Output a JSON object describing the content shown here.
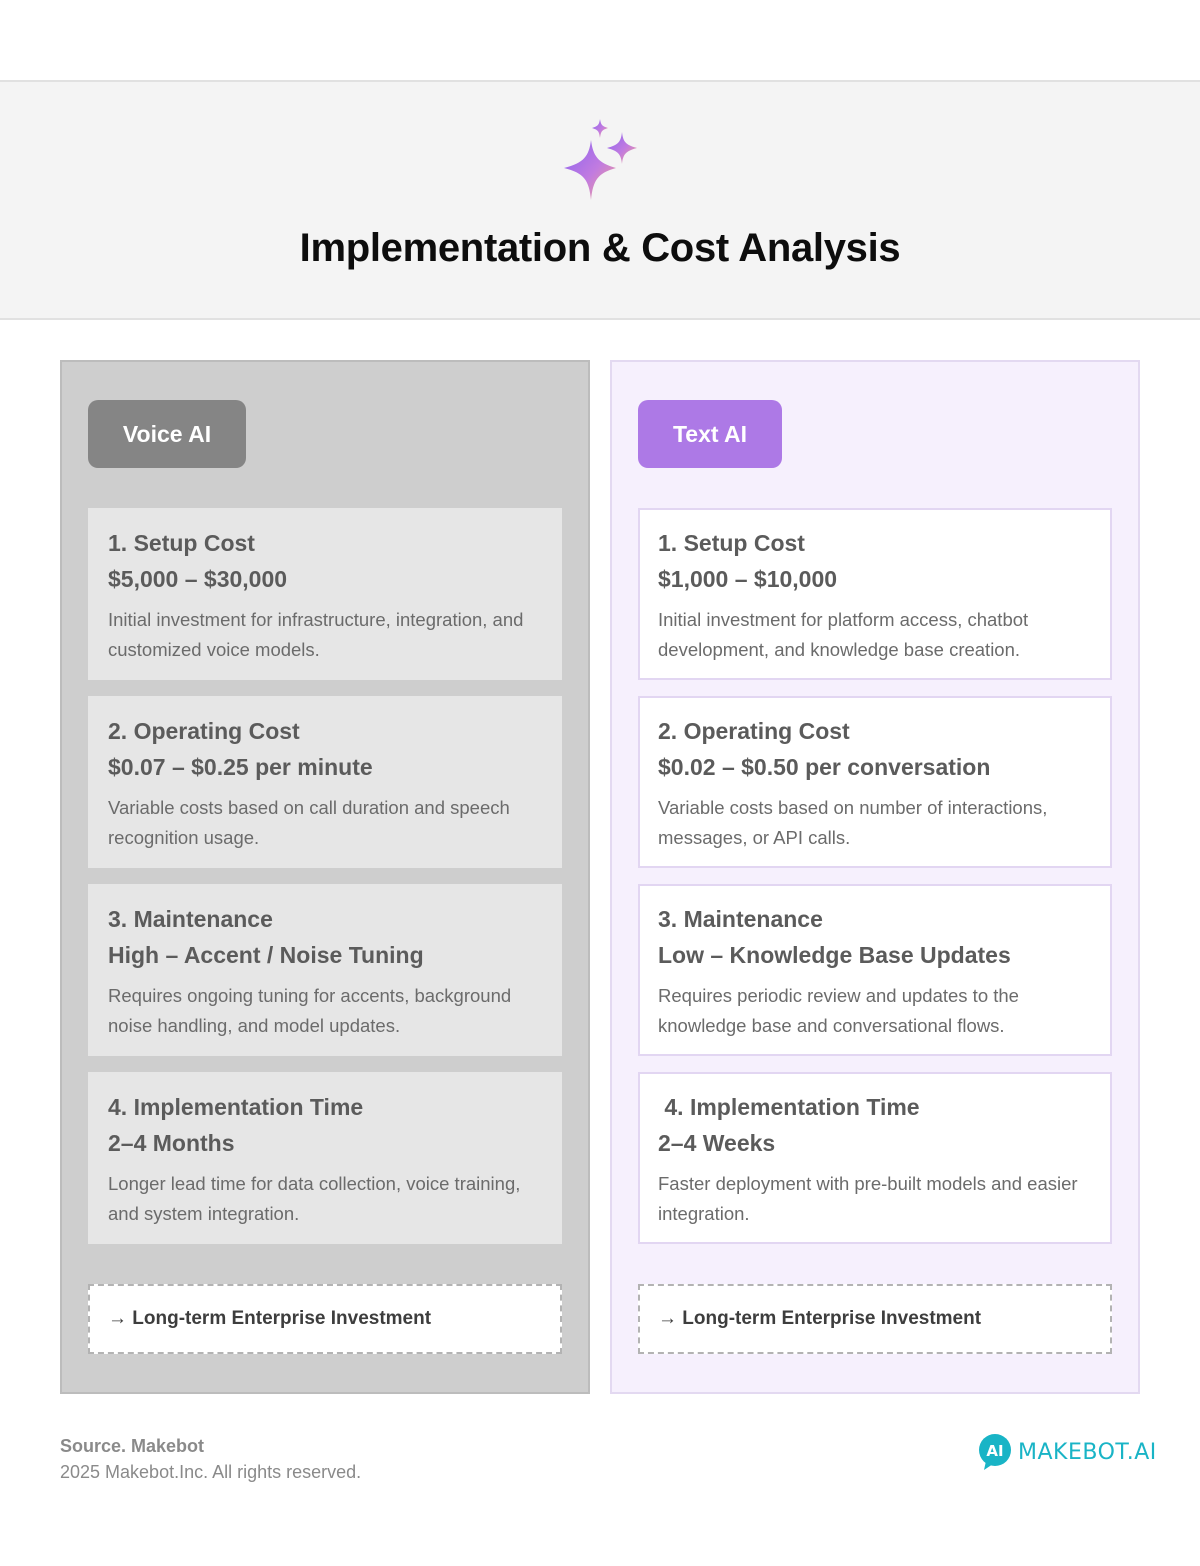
{
  "header": {
    "title": "Implementation & Cost Analysis",
    "icon": "sparkle-icon",
    "background": "#f4f4f4"
  },
  "voice": {
    "tag": "Voice AI",
    "tag_color": "#858585",
    "panel_color": "#cecece",
    "cards": [
      {
        "head": "1. Setup Cost",
        "value": "$5,000 – $30,000",
        "desc": "Initial investment for infrastructure, integration, and customized voice models."
      },
      {
        "head": "2. Operating Cost",
        "value": "$0.07 – $0.25 per minute",
        "desc": "Variable costs based on call duration and speech recognition usage."
      },
      {
        "head": "3. Maintenance",
        "value": "High – Accent / Noise Tuning",
        "desc": "Requires ongoing tuning for accents, background noise handling, and model updates."
      },
      {
        "head": "4. Implementation Time",
        "value": "2–4 Months",
        "desc": "Longer lead time for data collection, voice training, and system integration."
      }
    ],
    "footer": "→ Long-term Enterprise Investment"
  },
  "text": {
    "tag": "Text AI",
    "tag_color": "#ad79e6",
    "panel_color": "#f6f0fd",
    "cards": [
      {
        "head": "1. Setup Cost",
        "value": "$1,000 – $10,000",
        "desc": "Initial investment for platform access, chatbot development, and knowledge base creation."
      },
      {
        "head": "2. Operating Cost",
        "value": "$0.02 – $0.50 per conversation",
        "desc": "Variable costs based on number of interactions, messages, or API calls."
      },
      {
        "head": "3. Maintenance",
        "value": "Low – Knowledge Base Updates",
        "desc": "Requires periodic review and updates to the knowledge base and conversational flows."
      },
      {
        "head": " 4. Implementation Time",
        "value": "2–4 Weeks",
        "desc": "Faster deployment with pre-built models and easier integration."
      }
    ],
    "footer": "→ Long-term Enterprise Investment"
  },
  "footer": {
    "source": "Source. Makebot",
    "copyright": "2025 Makebot.Inc. All rights reserved.",
    "brand": "MAKEBOT.AI",
    "brand_color": "#19b4c6",
    "brand_icon": "makebot-logo-icon",
    "brand_icon_text": "AI"
  }
}
